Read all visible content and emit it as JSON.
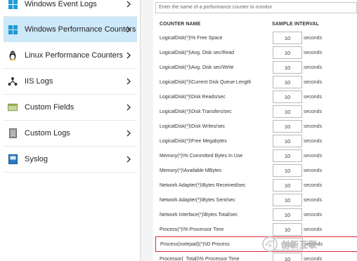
{
  "sidebar": {
    "items": [
      {
        "label": "Windows Event Logs",
        "icon": "windows-logo-icon",
        "active": false
      },
      {
        "label": "Windows Performance Counters",
        "icon": "windows-logo-icon",
        "active": true
      },
      {
        "label": "Linux Performance Counters",
        "icon": "linux-penguin-icon",
        "active": false
      },
      {
        "label": "IIS Logs",
        "icon": "iis-network-icon",
        "active": false
      },
      {
        "label": "Custom Fields",
        "icon": "custom-fields-icon",
        "active": false
      },
      {
        "label": "Custom Logs",
        "icon": "custom-logs-icon",
        "active": false
      },
      {
        "label": "Syslog",
        "icon": "syslog-icon",
        "active": false
      }
    ]
  },
  "main": {
    "search_placeholder": "Enter the name of a performance counter to monitor",
    "columns": {
      "name": "COUNTER NAME",
      "interval": "SAMPLE INTERVAL"
    },
    "rows": [
      {
        "name": "LogicalDisk(*)\\% Free Space",
        "value": "10",
        "unit": "seconds"
      },
      {
        "name": "LogicalDisk(*)\\Avg. Disk sec/Read",
        "value": "10",
        "unit": "seconds"
      },
      {
        "name": "LogicalDisk(*)\\Avg. Disk sec/Write",
        "value": "10",
        "unit": "seconds"
      },
      {
        "name": "LogicalDisk(*)\\Current Disk Queue Length",
        "value": "10",
        "unit": "seconds"
      },
      {
        "name": "LogicalDisk(*)\\Disk Reads/sec",
        "value": "10",
        "unit": "seconds"
      },
      {
        "name": "LogicalDisk(*)\\Disk Transfers/sec",
        "value": "10",
        "unit": "seconds"
      },
      {
        "name": "LogicalDisk(*)\\Disk Writes/sec",
        "value": "10",
        "unit": "seconds"
      },
      {
        "name": "LogicalDisk(*)\\Free Megabytes",
        "value": "10",
        "unit": "seconds"
      },
      {
        "name": "Memory(*)\\% Committed Bytes In Use",
        "value": "10",
        "unit": "seconds"
      },
      {
        "name": "Memory(*)\\Available MBytes",
        "value": "10",
        "unit": "seconds"
      },
      {
        "name": "Network Adapter(*)\\Bytes Received/sec",
        "value": "10",
        "unit": "seconds"
      },
      {
        "name": "Network Adapter(*)\\Bytes Sent/sec",
        "value": "10",
        "unit": "seconds"
      },
      {
        "name": "Network Interface(*)\\Bytes Total/sec",
        "value": "10",
        "unit": "seconds"
      },
      {
        "name": "Process(*)\\% Processor Time",
        "value": "10",
        "unit": "seconds"
      },
      {
        "name": "Process(notepad)(*)\\ID Process",
        "value": "10",
        "unit": "seconds",
        "highlighted": true
      },
      {
        "name": "Processor(_Total)\\% Processor Time",
        "value": "10",
        "unit": "seconds"
      }
    ]
  },
  "watermark": {
    "text": "创新互联",
    "icon": "watermark-logo-icon"
  },
  "colors": {
    "active_bg": "#cde8f8",
    "windows_blue": "#1e9ad6",
    "highlight_border": "#e0282e"
  }
}
